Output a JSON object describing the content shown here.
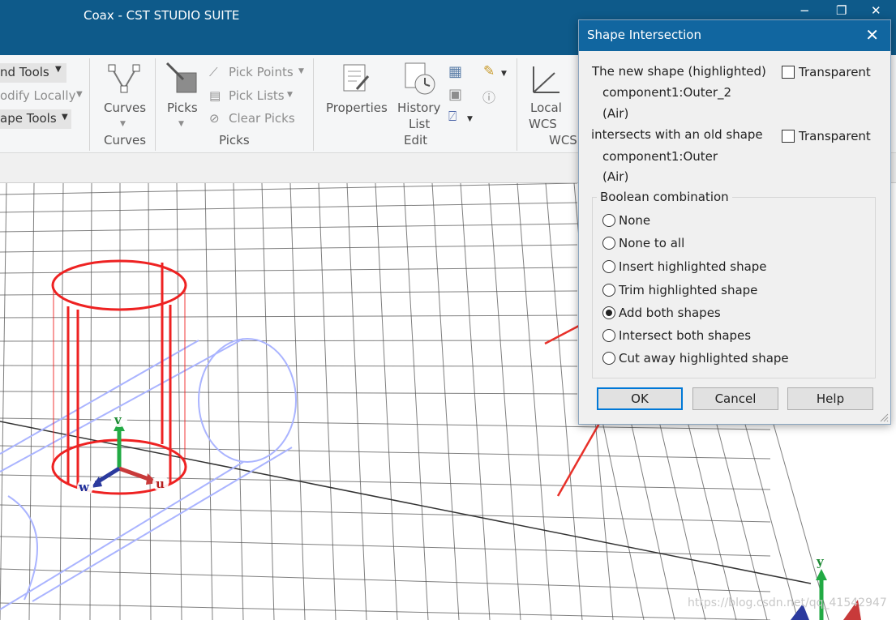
{
  "window": {
    "title": "Coax - CST STUDIO SUITE",
    "minimize": "−",
    "restore": "❐",
    "close": "✕"
  },
  "ribbon": {
    "left_items": [
      "nd Tools",
      "odify Locally",
      "ape Tools"
    ],
    "curves": {
      "label": "Curves",
      "group": "Curves"
    },
    "picks": {
      "label": "Picks",
      "items": [
        "Pick Points",
        "Pick Lists",
        "Clear Picks"
      ],
      "group": "Picks"
    },
    "edit": {
      "properties": "Properties",
      "history_line1": "History",
      "history_line2": "List",
      "group": "Edit"
    },
    "wcs": {
      "line1": "Local",
      "line2": "WCS",
      "group": "WCS"
    }
  },
  "viewport": {
    "axis_labels": {
      "v": "v",
      "w": "w",
      "u": "u",
      "y": "y"
    }
  },
  "dialog": {
    "title": "Shape Intersection",
    "new_shape_text": "The new shape (highlighted)",
    "new_shape_name": "component1:Outer_2",
    "new_shape_material": "(Air)",
    "intersects_text": "intersects with an old shape",
    "old_shape_name": "component1:Outer",
    "old_shape_material": "(Air)",
    "transparent_label": "Transparent",
    "group_label": "Boolean combination",
    "options": [
      "None",
      "None to all",
      "Insert highlighted shape",
      "Trim highlighted shape",
      "Add both shapes",
      "Intersect both shapes",
      "Cut away highlighted shape"
    ],
    "selected_option": "Add both shapes",
    "ok": "OK",
    "cancel": "Cancel",
    "help": "Help"
  },
  "watermark": "https://blog.csdn.net/qq_41542947",
  "colors": {
    "titlebar": "#0e5a8a",
    "dialog_title": "#1166a0",
    "annotation_arrow": "#e8312a",
    "highlight_shape": "#ee2222",
    "old_shape": "#aab4ff"
  }
}
